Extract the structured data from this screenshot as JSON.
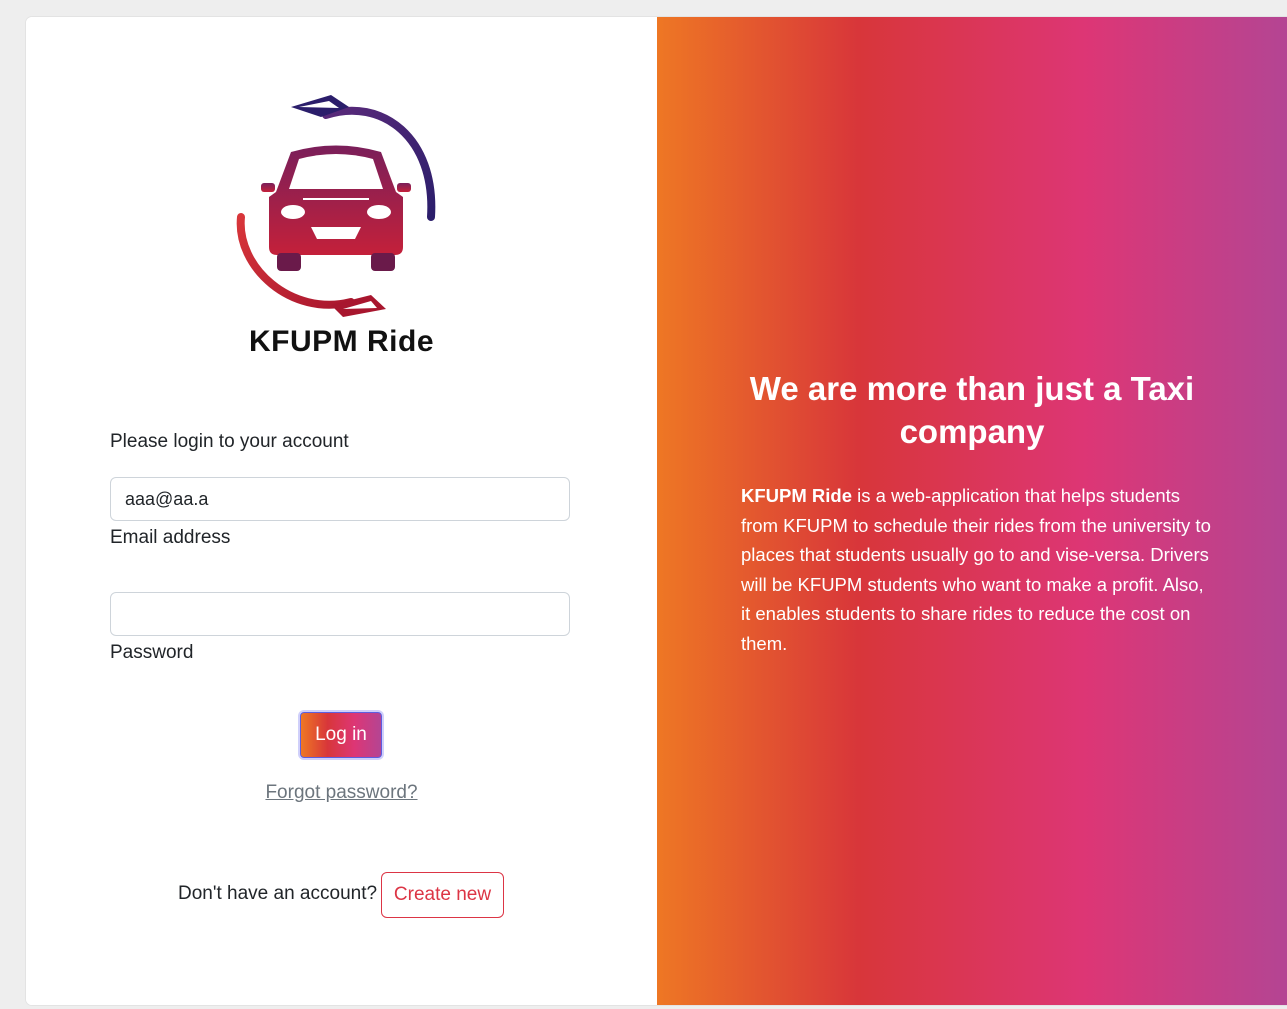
{
  "login": {
    "brand": "KFUPM Ride",
    "prompt": "Please login to your account",
    "email": {
      "value": "aaa@aa.a",
      "label": "Email address"
    },
    "password": {
      "value": "",
      "label": "Password"
    },
    "login_button": "Log in",
    "forgot_link": "Forgot password?",
    "no_account_text": "Don't have an account?",
    "create_button": "Create new"
  },
  "promo": {
    "headline": "We are more than just a Taxi company",
    "description_brand": "KFUPM Ride",
    "description_text": " is a web-application that helps students from KFUPM to schedule their rides from the university to places that students usually go to and vise-versa. Drivers will be KFUPM students who want to make a profit. Also, it enables students to share rides to reduce the cost on them."
  },
  "colors": {
    "gradient": [
      "#ee7724",
      "#d8363a",
      "#dd3675",
      "#b44593"
    ],
    "danger": "#dc3545",
    "logo_dark": "#2b1e6b",
    "logo_red": "#c4203a"
  },
  "icons": {
    "logo": "car-with-hands-logo-icon"
  }
}
